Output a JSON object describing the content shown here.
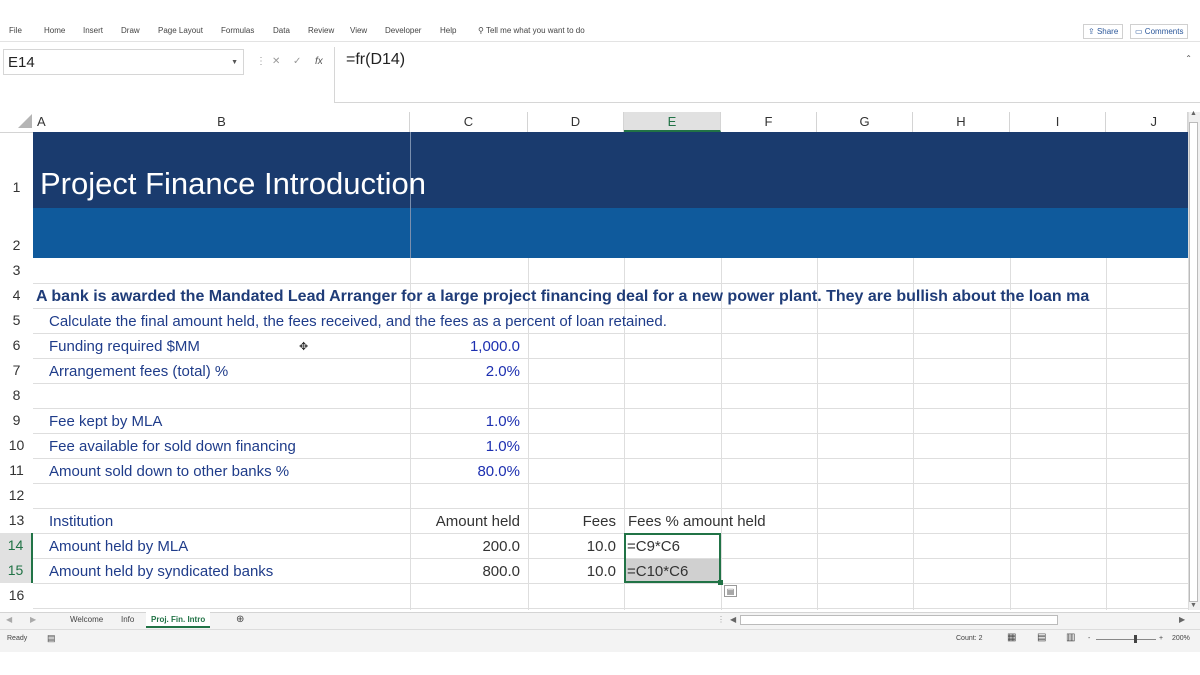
{
  "ribbon": {
    "tabs": [
      "File",
      "Home",
      "Insert",
      "Draw",
      "Page Layout",
      "Formulas",
      "Data",
      "Review",
      "View",
      "Developer",
      "Help"
    ],
    "tell_me": "Tell me what you want to do",
    "share": "Share",
    "comments": "Comments"
  },
  "formula_bar": {
    "name_box": "E14",
    "formula": "=fr(D14)",
    "cancel_glyph": "✕",
    "enter_glyph": "✓",
    "fx_glyph": "fx"
  },
  "columns": [
    "A",
    "B",
    "C",
    "D",
    "E",
    "F",
    "G",
    "H",
    "I",
    "J"
  ],
  "selected_column": "E",
  "rows": [
    "1",
    "2",
    "3",
    "4",
    "5",
    "6",
    "7",
    "8",
    "9",
    "10",
    "11",
    "12",
    "13",
    "14",
    "15",
    "16"
  ],
  "selected_rows": [
    "14",
    "15"
  ],
  "sheet": {
    "title": "Project Finance Introduction",
    "r4": "A bank is awarded the Mandated Lead Arranger for a large project financing deal for a new power plant. They are bullish about the loan ma",
    "r5": "Calculate the final amount held, the fees received, and the fees as a percent of loan retained.",
    "r6": {
      "label": "Funding required $MM",
      "value": "1,000.0"
    },
    "r7": {
      "label": "Arrangement fees (total) %",
      "value": "2.0%"
    },
    "r9": {
      "label": "Fee kept by MLA",
      "value": "1.0%"
    },
    "r10": {
      "label": "Fee available for sold down financing",
      "value": "1.0%"
    },
    "r11": {
      "label": "Amount sold down to other banks %",
      "value": "80.0%"
    },
    "r13": {
      "b": "Institution",
      "c": "Amount held",
      "d": "Fees",
      "e": "Fees % amount held"
    },
    "r14": {
      "b": "Amount held by MLA",
      "c": "200.0",
      "d": "10.0",
      "e": "=C9*C6"
    },
    "r15": {
      "b": "Amount held by syndicated banks",
      "c": "800.0",
      "d": "10.0",
      "e": "=C10*C6"
    }
  },
  "sheet_tabs": [
    "Welcome",
    "Info",
    "Proj. Fin. Intro"
  ],
  "active_sheet": "Proj. Fin. Intro",
  "status": {
    "ready": "Ready",
    "count": "Count: 2",
    "zoom": "200%"
  },
  "colors": {
    "accent": "#217346",
    "title_band": "#1a3b6e",
    "subtitle_band": "#0f5a9c",
    "text_blue": "#1f3c8a"
  }
}
